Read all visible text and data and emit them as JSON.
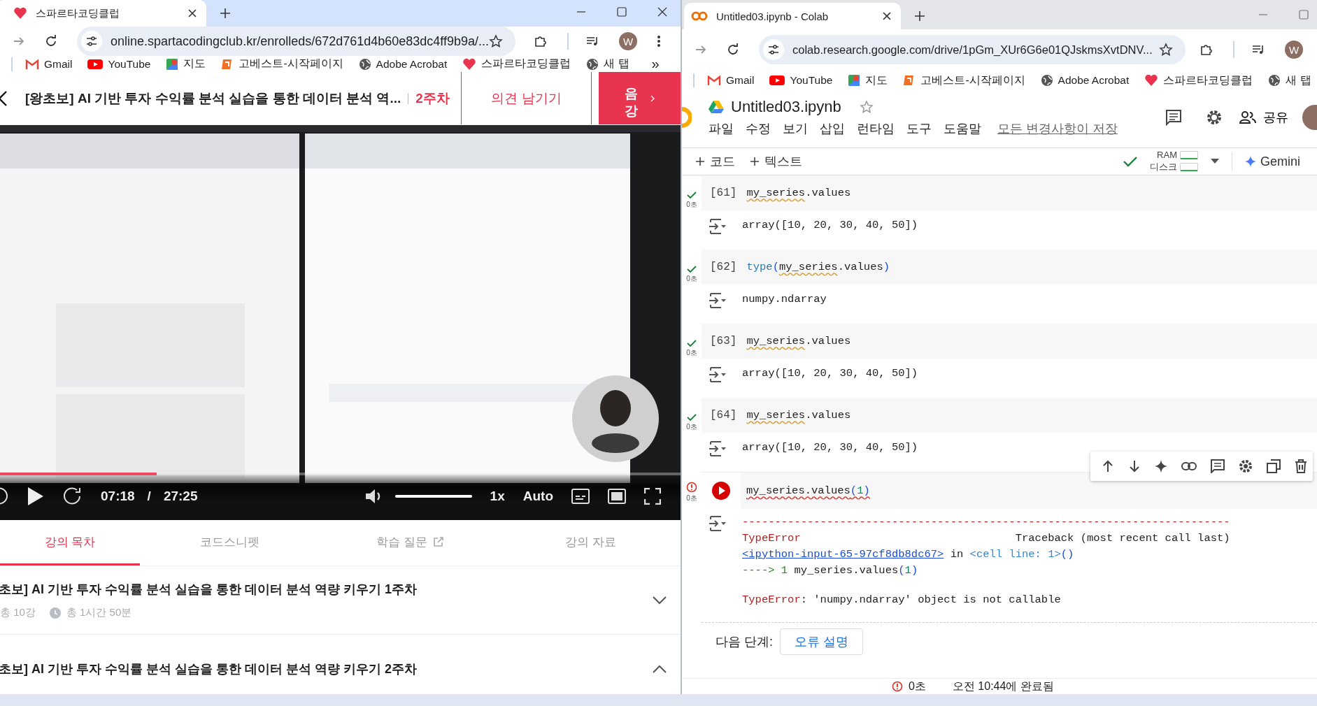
{
  "left_window": {
    "tab_title": "스파르타코딩클럽",
    "address": "online.spartacodingclub.kr/enrolleds/672d761d4b60e83dc4ff9b9a/...",
    "profile": "W",
    "bookmarks": [
      {
        "label": "Gmail",
        "kind": "gmail"
      },
      {
        "label": "YouTube",
        "kind": "youtube"
      },
      {
        "label": "지도",
        "kind": "maps"
      },
      {
        "label": "고베스트-시작페이지",
        "kind": "gobest"
      },
      {
        "label": "Adobe Acrobat",
        "kind": "globe"
      },
      {
        "label": "스파르타코딩클럽",
        "kind": "sparta"
      },
      {
        "label": "새 탭",
        "kind": "globe"
      }
    ],
    "bookmarks_more": "»",
    "course": {
      "title": "[왕초보] AI 기반 투자 수익률 분석 실습을 통한 데이터 분석 역...",
      "week": "2주차",
      "feedback": "의견 남기기",
      "next": "음강"
    },
    "player": {
      "progress": {
        "level": 0.23
      },
      "current_time": "07:18",
      "separator": "/",
      "duration": "27:25",
      "volume": {
        "level": 1
      },
      "speed": "1x",
      "quality": "Auto"
    },
    "tabs": [
      {
        "label": "강의 목차",
        "selected": true,
        "external": false
      },
      {
        "label": "코드스니펫",
        "selected": false,
        "external": false
      },
      {
        "label": "학습 질문",
        "selected": false,
        "external": true
      },
      {
        "label": "강의 자료",
        "selected": false,
        "external": false
      }
    ],
    "sections": [
      {
        "title": "초보] AI 기반 투자 수익률 분석 실습을 통한 데이터 분석 역량 키우기 1주차",
        "lectures": "총 10강",
        "duration": "총 1시간 50분",
        "expanded": false
      },
      {
        "title": "초보] AI 기반 투자 수익률 분석 실습을 통한 데이터 분석 역량 키우기 2주차",
        "expanded": true
      }
    ]
  },
  "right_window": {
    "tab_title": "Untitled03.ipynb - Colab",
    "address": "colab.research.google.com/drive/1pGm_XUr6G6e01QJskmsXvtDNV...",
    "profile": "W",
    "bookmarks": [
      {
        "label": "Gmail",
        "kind": "gmail"
      },
      {
        "label": "YouTube",
        "kind": "youtube"
      },
      {
        "label": "지도",
        "kind": "maps"
      },
      {
        "label": "고베스트-시작페이지",
        "kind": "gobest"
      },
      {
        "label": "Adobe Acrobat",
        "kind": "globe"
      },
      {
        "label": "스파르타코딩클럽",
        "kind": "sparta"
      },
      {
        "label": "새 탭",
        "kind": "globe"
      }
    ],
    "notebook": {
      "filename": "Untitled03.ipynb",
      "menu": [
        "파일",
        "수정",
        "보기",
        "삽입",
        "런타임",
        "도구",
        "도움말"
      ],
      "save_status": "모든 변경사항이 저장",
      "share": "공유",
      "add_code": "코드",
      "add_text": "텍스트",
      "ram": "RAM",
      "disk": "디스크",
      "gemini": "Gemini",
      "cells": [
        {
          "error": false,
          "time": "0초",
          "number": "[61]",
          "code": [
            {
              "text": "my_series",
              "kind": "text",
              "flagged": true
            },
            {
              "text": ".values",
              "kind": "text"
            }
          ],
          "output": [
            {
              "kind": "line",
              "parts": [
                {
                  "text": "array([10, 20, 30, 40, 50])",
                  "kind": "text"
                }
              ]
            }
          ]
        },
        {
          "error": false,
          "time": "0초",
          "number": "[62]",
          "code": [
            {
              "text": "type",
              "kind": "builtin"
            },
            {
              "text": "(",
              "kind": "bracket"
            },
            {
              "text": "my_series",
              "kind": "text",
              "flagged": true
            },
            {
              "text": ".values",
              "kind": "text"
            },
            {
              "text": ")",
              "kind": "bracket"
            }
          ],
          "output": [
            {
              "kind": "line",
              "parts": [
                {
                  "text": "numpy.ndarray",
                  "kind": "text"
                }
              ]
            }
          ]
        },
        {
          "error": false,
          "time": "0초",
          "number": "[63]",
          "code": [
            {
              "text": "my_series",
              "kind": "text",
              "flagged": true
            },
            {
              "text": ".values",
              "kind": "text"
            }
          ],
          "output": [
            {
              "kind": "line",
              "parts": [
                {
                  "text": "array([10, 20, 30, 40, 50])",
                  "kind": "text"
                }
              ]
            }
          ]
        },
        {
          "error": false,
          "time": "0초",
          "number": "[64]",
          "code": [
            {
              "text": "my_series",
              "kind": "text",
              "flagged": true
            },
            {
              "text": ".values",
              "kind": "text"
            }
          ],
          "output": [
            {
              "kind": "line",
              "parts": [
                {
                  "text": "array([10, 20, 30, 40, 50])",
                  "kind": "text"
                }
              ]
            }
          ]
        },
        {
          "error": true,
          "time": "0초",
          "code": [
            {
              "text": "my_series.values",
              "kind": "text",
              "flagged": true
            },
            {
              "text": "(",
              "kind": "bracket",
              "flagged": true
            },
            {
              "text": "1",
              "kind": "number",
              "flagged": true
            },
            {
              "text": ")",
              "kind": "bracket",
              "flagged": true
            }
          ],
          "output": [
            {
              "kind": "rule",
              "parts": [
                {
                  "text": "---------------------------------------------------------------------------",
                  "kind": "error_name"
                }
              ]
            },
            {
              "kind": "split",
              "parts": [
                {
                  "text": "TypeError",
                  "kind": "error_name"
                },
                {
                  "text": "Traceback (most recent call last)",
                  "kind": "text"
                }
              ]
            },
            {
              "kind": "line",
              "parts": [
                {
                  "text": "<ipython-input-65-97cf8db8dc67>",
                  "kind": "link"
                },
                {
                  "text": " in ",
                  "kind": "text"
                },
                {
                  "text": "<cell line: 1>",
                  "kind": "location"
                },
                {
                  "text": "()",
                  "kind": "bracket"
                }
              ]
            },
            {
              "kind": "line",
              "parts": [
                {
                  "text": "----> 1 ",
                  "kind": "arrow"
                },
                {
                  "text": "my_series.values",
                  "kind": "text"
                },
                {
                  "text": "(",
                  "kind": "bracket"
                },
                {
                  "text": "1",
                  "kind": "number"
                },
                {
                  "text": ")",
                  "kind": "bracket"
                }
              ]
            },
            {
              "kind": "message",
              "parts": [
                {
                  "text": "TypeError",
                  "kind": "error_name"
                },
                {
                  "text": ": 'numpy.ndarray' object is not callable",
                  "kind": "text"
                }
              ]
            }
          ]
        }
      ],
      "next_steps": {
        "label": "다음 단계:",
        "button": "오류 설명"
      }
    },
    "status_bar": {
      "time": "0초",
      "message": "오전 10:44에 완료됨"
    }
  }
}
